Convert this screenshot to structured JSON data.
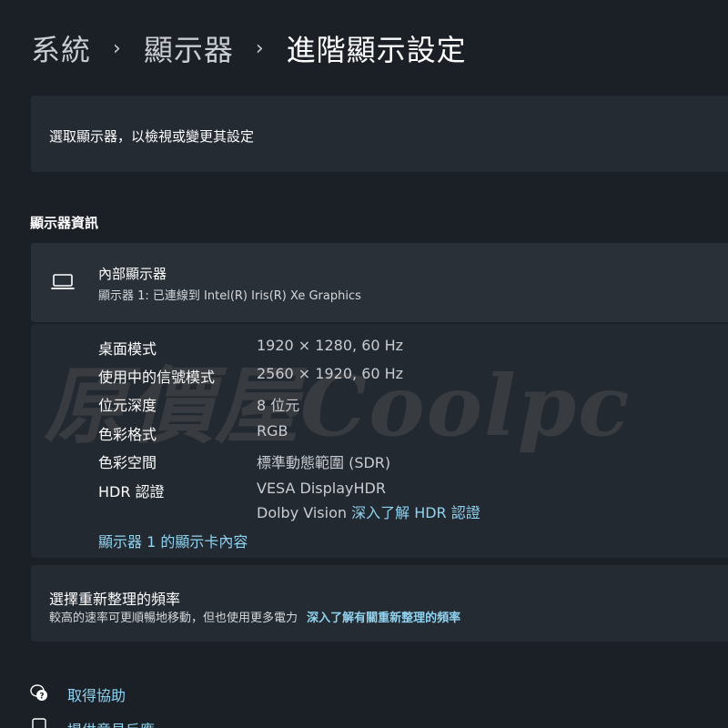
{
  "breadcrumb": {
    "items": [
      "系統",
      "顯示器",
      "進階顯示設定"
    ],
    "separator": "›"
  },
  "select_display": {
    "text": "選取顯示器，以檢視或變更其設定"
  },
  "display_info": {
    "section_title": "顯示器資訊",
    "display_name": "內部顯示器",
    "display_subtitle": "顯示器 1: 已連線到 Intel(R) Iris(R) Xe Graphics",
    "icon": "laptop-icon",
    "rows": [
      {
        "label": "桌面模式",
        "value": "1920 × 1280, 60 Hz"
      },
      {
        "label": "使用中的信號模式",
        "value": "2560 × 1920, 60 Hz"
      },
      {
        "label": "位元深度",
        "value": "8 位元"
      },
      {
        "label": "色彩格式",
        "value": "RGB"
      },
      {
        "label": "色彩空間",
        "value": "標準動態範圍 (SDR)"
      },
      {
        "label": "HDR 認證",
        "value": "VESA DisplayHDR"
      }
    ],
    "hdr_extra": "Dolby Vision",
    "hdr_link": "深入了解 HDR 認證",
    "adapter_link": "顯示器 1 的顯示卡內容"
  },
  "refresh": {
    "title": "選擇重新整理的頻率",
    "subtitle": "較高的速率可更順暢地移動，但也使用更多電力",
    "link": "深入了解有關重新整理的頻率"
  },
  "footer": {
    "help_label": "取得協助",
    "help_icon": "help-chat-icon",
    "feedback_label": "提供意見反應",
    "feedback_icon": "feedback-icon"
  },
  "watermark": "原價屋Coolpc",
  "colors": {
    "background": "#1b2027",
    "card": "#252b33",
    "link": "#8fd3f0"
  }
}
